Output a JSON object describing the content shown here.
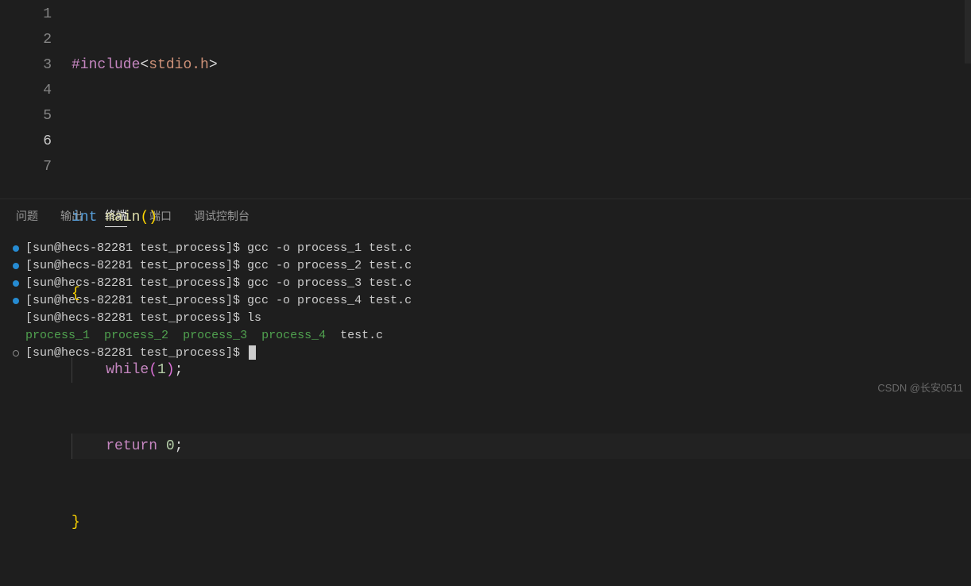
{
  "editor": {
    "lines": [
      {
        "num": "1"
      },
      {
        "num": "2"
      },
      {
        "num": "3"
      },
      {
        "num": "4"
      },
      {
        "num": "5"
      },
      {
        "num": "6"
      },
      {
        "num": "7"
      }
    ],
    "tokens": {
      "l1_include": "#include",
      "l1_angle_open": "<",
      "l1_header": "stdio.h",
      "l1_angle_close": ">",
      "l3_int": "int",
      "l3_main": "main",
      "l3_open": "(",
      "l3_close": ")",
      "l4_brace": "{",
      "l5_while": "while",
      "l5_open": "(",
      "l5_one": "1",
      "l5_close": ")",
      "l5_semi": ";",
      "l6_return": "return",
      "l6_zero": "0",
      "l6_semi": ";",
      "l7_brace": "}"
    }
  },
  "panel": {
    "tabs": {
      "problems": "问题",
      "output": "输出",
      "terminal": "终端",
      "ports": "端口",
      "debug_console": "调试控制台"
    }
  },
  "terminal": {
    "prompt_base": "[sun@hecs-82281 test_process]$ ",
    "cmd1": "gcc -o process_1 test.c",
    "cmd2": "gcc -o process_2 test.c",
    "cmd3": "gcc -o process_3 test.c",
    "cmd4": "gcc -o process_4 test.c",
    "cmd5": "ls",
    "ls_result": {
      "p1": "process_1",
      "p2": "process_2",
      "p3": "process_3",
      "p4": "process_4",
      "file": "test.c"
    }
  },
  "watermark": "CSDN @长安0511"
}
